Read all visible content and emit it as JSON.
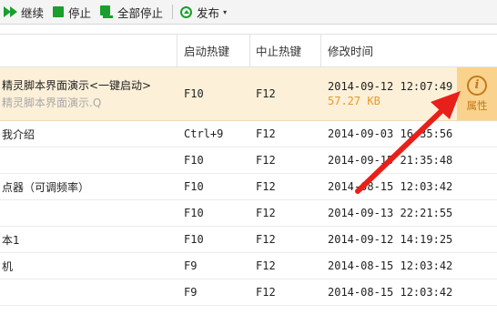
{
  "toolbar": {
    "continue_label": "继续",
    "stop_label": "停止",
    "stop_all_label": "全部停止",
    "publish_label": "发布",
    "publish_caret": "▾"
  },
  "table": {
    "columns": [
      "",
      "启动热键",
      "中止热键",
      "修改时间"
    ],
    "selected": {
      "name": "精灵脚本界面演示<一键启动>",
      "subname": "精灵脚本界面演示.Q",
      "start_key": "F10",
      "stop_key": "F12",
      "time": "2014-09-12 12:07:49",
      "size": "57.27 KB",
      "props_icon": "i",
      "props_label": "属性"
    },
    "rows": [
      {
        "name": "我介绍",
        "start_key": "Ctrl+9",
        "stop_key": "F12",
        "time": "2014-09-03 16:35:56"
      },
      {
        "name": "",
        "start_key": "F10",
        "stop_key": "F12",
        "time": "2014-09-15 21:35:48"
      },
      {
        "name": "点器（可调频率）",
        "start_key": "F10",
        "stop_key": "F12",
        "time": "2014-08-15 12:03:42"
      },
      {
        "name": "",
        "start_key": "F10",
        "stop_key": "F12",
        "time": "2014-09-13 22:21:55"
      },
      {
        "name": "本1",
        "start_key": "F10",
        "stop_key": "F12",
        "time": "2014-09-12 14:19:25"
      },
      {
        "name": "机",
        "start_key": "F9",
        "stop_key": "F12",
        "time": "2014-08-15 12:03:42"
      },
      {
        "name": "",
        "start_key": "F9",
        "stop_key": "F12",
        "time": "2014-08-15 12:03:42"
      }
    ]
  },
  "colors": {
    "accent_green": "#1a9e2e",
    "selected_row": "#fdf0d9",
    "props_bg": "#f9d38e",
    "annotation_arrow": "#e8201a"
  },
  "icons": {
    "continue": "play-double-icon",
    "stop": "stop-square-icon",
    "stop_all": "stop-all-icon",
    "publish": "publish-upload-icon",
    "properties": "info-circle-icon"
  }
}
